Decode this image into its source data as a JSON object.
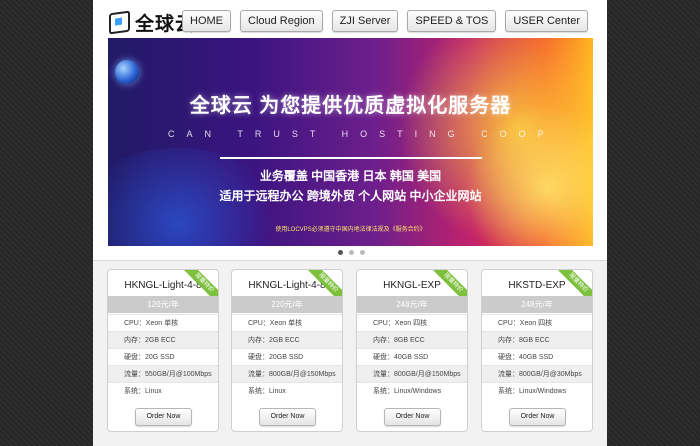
{
  "logo": {
    "text": "全球云"
  },
  "nav": [
    {
      "label": "HOME"
    },
    {
      "label": "Cloud Region"
    },
    {
      "label": "ZJI Server"
    },
    {
      "label": "SPEED & TOS"
    },
    {
      "label": "USER Center"
    }
  ],
  "banner": {
    "headline": "全球云  为您提供优质虚拟化服务器",
    "spaced": "CAN TRUST HOSTING COOP",
    "line1": "业务覆盖 中国香港 日本 韩国 美国",
    "line2": "适用于远程办公  跨境外贸  个人网站  中小企业网站",
    "notice": "使用LOCVPS必须遵守中国内地法律法规及《服务合约》"
  },
  "plans": [
    {
      "name": "HKNGL-Light-4-8",
      "ribbon": "限量特价",
      "price": "120元/年",
      "specs": [
        "CPU：Xeon 单核",
        "内存：2GB ECC",
        "硬盘：20G SSD",
        "流量：550GB/月@100Mbps",
        "系统：Linux"
      ],
      "order": "Order Now"
    },
    {
      "name": "HKNGL-Light-4-8",
      "ribbon": "限量特价",
      "price": "220元/年",
      "specs": [
        "CPU：Xeon 单核",
        "内存：2GB ECC",
        "硬盘：20GB SSD",
        "流量：800GB/月@150Mbps",
        "系统：Linux"
      ],
      "order": "Order Now"
    },
    {
      "name": "HKNGL-EXP",
      "ribbon": "限量特价",
      "price": "248元/年",
      "specs": [
        "CPU：Xeon 四核",
        "内存：8GB ECC",
        "硬盘：40GB SSD",
        "流量：800GB/月@150Mbps",
        "系统：Linux/Windows"
      ],
      "order": "Order Now"
    },
    {
      "name": "HKSTD-EXP",
      "ribbon": "限量特价",
      "price": "248元/年",
      "specs": [
        "CPU：Xeon 四核",
        "内存：8GB ECC",
        "硬盘：40GB SSD",
        "流量：800GB/月@30Mbps",
        "系统：Linux/Windows"
      ],
      "order": "Order Now"
    }
  ],
  "colors": {
    "ribbon": "#7cc03c",
    "price_band": "#cbcbcb",
    "page_bg": "#2a2a2a"
  }
}
